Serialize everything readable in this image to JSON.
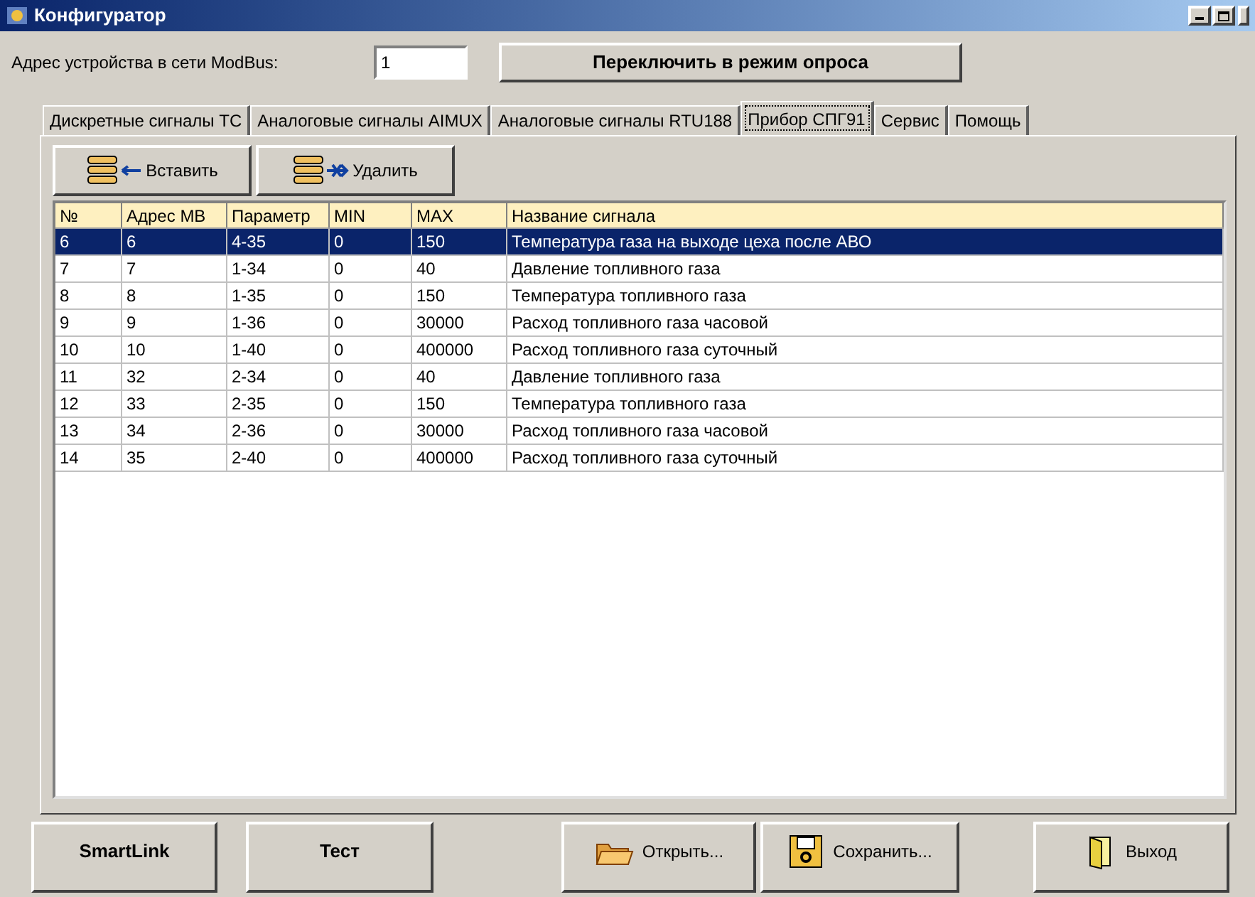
{
  "window": {
    "title": "Конфигуратор"
  },
  "address": {
    "label": "Адрес устройства в сети ModBus:",
    "value": "1"
  },
  "switch_button": "Переключить в режим опроса",
  "tabs": [
    {
      "label": "Дискретные сигналы ТС",
      "selected": false
    },
    {
      "label": "Аналоговые сигналы AIMUX",
      "selected": false
    },
    {
      "label": "Аналоговые сигналы RTU188",
      "selected": false
    },
    {
      "label": "Прибор СПГ91",
      "selected": true
    },
    {
      "label": "Сервис",
      "selected": false
    },
    {
      "label": "Помощь",
      "selected": false
    }
  ],
  "toolbar": [
    {
      "kind": "insert",
      "label": "Вставить"
    },
    {
      "kind": "delete",
      "label": "Удалить"
    }
  ],
  "table": {
    "columns": [
      "№",
      "Адрес МВ",
      "Параметр",
      "MIN",
      "MAX",
      "Название сигнала"
    ],
    "rows": [
      {
        "cells": [
          "6",
          "6",
          "4-35",
          "0",
          "150",
          "Температура газа на выходе цеха после АВО"
        ],
        "selected": true
      },
      {
        "cells": [
          "7",
          "7",
          "1-34",
          "0",
          "40",
          "Давление топливного газа"
        ],
        "selected": false
      },
      {
        "cells": [
          "8",
          "8",
          "1-35",
          "0",
          "150",
          "Температура топливного газа"
        ],
        "selected": false
      },
      {
        "cells": [
          "9",
          "9",
          "1-36",
          "0",
          "30000",
          "Расход топливного газа часовой"
        ],
        "selected": false
      },
      {
        "cells": [
          "10",
          "10",
          "1-40",
          "0",
          "400000",
          "Расход топливного газа суточный"
        ],
        "selected": false
      },
      {
        "cells": [
          "11",
          "32",
          "2-34",
          "0",
          "40",
          "Давление топливного газа"
        ],
        "selected": false
      },
      {
        "cells": [
          "12",
          "33",
          "2-35",
          "0",
          "150",
          "Температура топливного газа"
        ],
        "selected": false
      },
      {
        "cells": [
          "13",
          "34",
          "2-36",
          "0",
          "30000",
          "Расход топливного газа часовой"
        ],
        "selected": false
      },
      {
        "cells": [
          "14",
          "35",
          "2-40",
          "0",
          "400000",
          "Расход топливного газа суточный"
        ],
        "selected": false
      }
    ]
  },
  "bottom_buttons": [
    {
      "kind": "plain",
      "label": "SmartLink"
    },
    {
      "kind": "plain",
      "label": "Тест"
    },
    {
      "kind": "open",
      "label": "Открыть..."
    },
    {
      "kind": "save",
      "label": "Сохранить..."
    },
    {
      "kind": "exit",
      "label": "Выход"
    }
  ]
}
